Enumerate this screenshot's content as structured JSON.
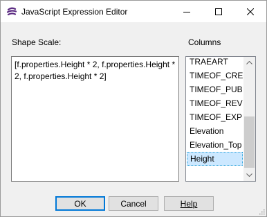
{
  "window": {
    "title": "JavaScript Expression Editor",
    "controls": {
      "minimize": "minimize",
      "maximize": "maximize",
      "close": "close"
    }
  },
  "labels": {
    "shape_scale": "Shape Scale:",
    "columns": "Columns"
  },
  "expression": {
    "value": "[f.properties.Height * 2, f.properties.Height * 2, f.properties.Height * 2]"
  },
  "columns_list": {
    "items": [
      {
        "label": "TRAEART"
      },
      {
        "label": "TIMEOF_CRE"
      },
      {
        "label": "TIMEOF_PUB"
      },
      {
        "label": "TIMEOF_REV"
      },
      {
        "label": "TIMEOF_EXP"
      },
      {
        "label": "Elevation"
      },
      {
        "label": "Elevation_Top"
      },
      {
        "label": "Height"
      }
    ],
    "selected": "Height",
    "scroll_position": 1.0
  },
  "buttons": {
    "ok": "OK",
    "cancel": "Cancel",
    "help": "Help"
  },
  "colors": {
    "selection": "#cce8ff",
    "default_button_border": "#0078d7",
    "app_icon": "#5b2b82"
  }
}
